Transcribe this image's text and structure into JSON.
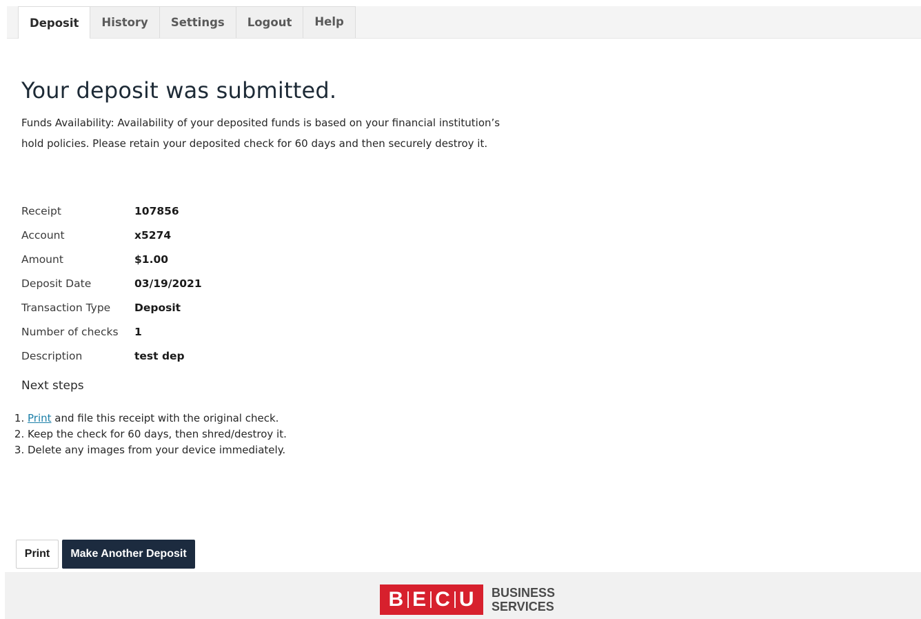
{
  "tabs": [
    {
      "label": "Deposit",
      "active": true
    },
    {
      "label": "History"
    },
    {
      "label": "Settings"
    },
    {
      "label": "Logout"
    },
    {
      "label": "Help"
    }
  ],
  "page": {
    "title": "Your deposit was submitted.",
    "funds_availability": "Funds Availability: Availability of your deposited funds is based on your financial institution’s hold policies. Please retain your deposited check for 60 days and then securely destroy it."
  },
  "details": [
    {
      "label": "Receipt",
      "value": "107856"
    },
    {
      "label": "Account",
      "value": "x5274"
    },
    {
      "label": "Amount",
      "value": "$1.00"
    },
    {
      "label": "Deposit Date",
      "value": "03/19/2021"
    },
    {
      "label": "Transaction Type",
      "value": "Deposit"
    },
    {
      "label": "Number of checks",
      "value": "1"
    },
    {
      "label": "Description",
      "value": "test dep"
    }
  ],
  "next_steps": {
    "title": "Next steps",
    "step1_link": "Print",
    "step1_rest": " and file this receipt with the original check.",
    "step2": "Keep the check for 60 days, then shred/destroy it.",
    "step3": "Delete any images from your device immediately."
  },
  "buttons": {
    "print": "Print",
    "make_another": "Make Another Deposit"
  },
  "footer": {
    "logo_letters": [
      "B",
      "E",
      "C",
      "U"
    ],
    "logo_line1": "BUSINESS",
    "logo_line2": "SERVICES"
  },
  "colors": {
    "primary_button": "#1c2b3f",
    "brand_red": "#d7202d",
    "link": "#1b7fa8"
  }
}
